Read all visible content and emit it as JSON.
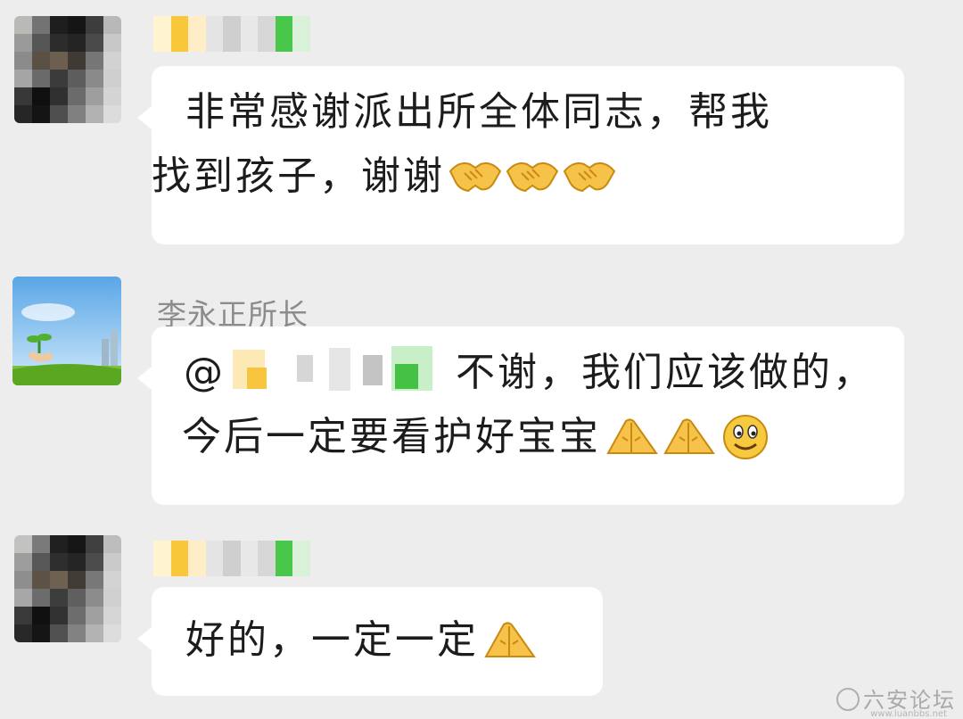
{
  "chat": {
    "messages": [
      {
        "sender": "",
        "lines": [
          "非常感谢派出所全体同志，帮我",
          "找到孩子，谢谢"
        ],
        "emojis": [
          "handshake-icon",
          "handshake-icon",
          "handshake-icon"
        ]
      },
      {
        "sender": "李永正所长",
        "mention": "@",
        "lines": [
          "不谢，我们应该做的，",
          "今后一定要看护好宝宝"
        ],
        "emojis": [
          "folded-hands-icon",
          "folded-hands-icon",
          "smiley-icon"
        ]
      },
      {
        "sender": "",
        "lines": [
          "好的，一定一定"
        ],
        "emojis": [
          "folded-hands-icon"
        ]
      }
    ]
  },
  "watermark": {
    "text": "六安论坛",
    "url": "www.luanbbs.net"
  },
  "colors": {
    "background": "#ededed",
    "bubble": "#ffffff",
    "sender_name": "#8c8c8c",
    "text": "#1c1c1c"
  }
}
